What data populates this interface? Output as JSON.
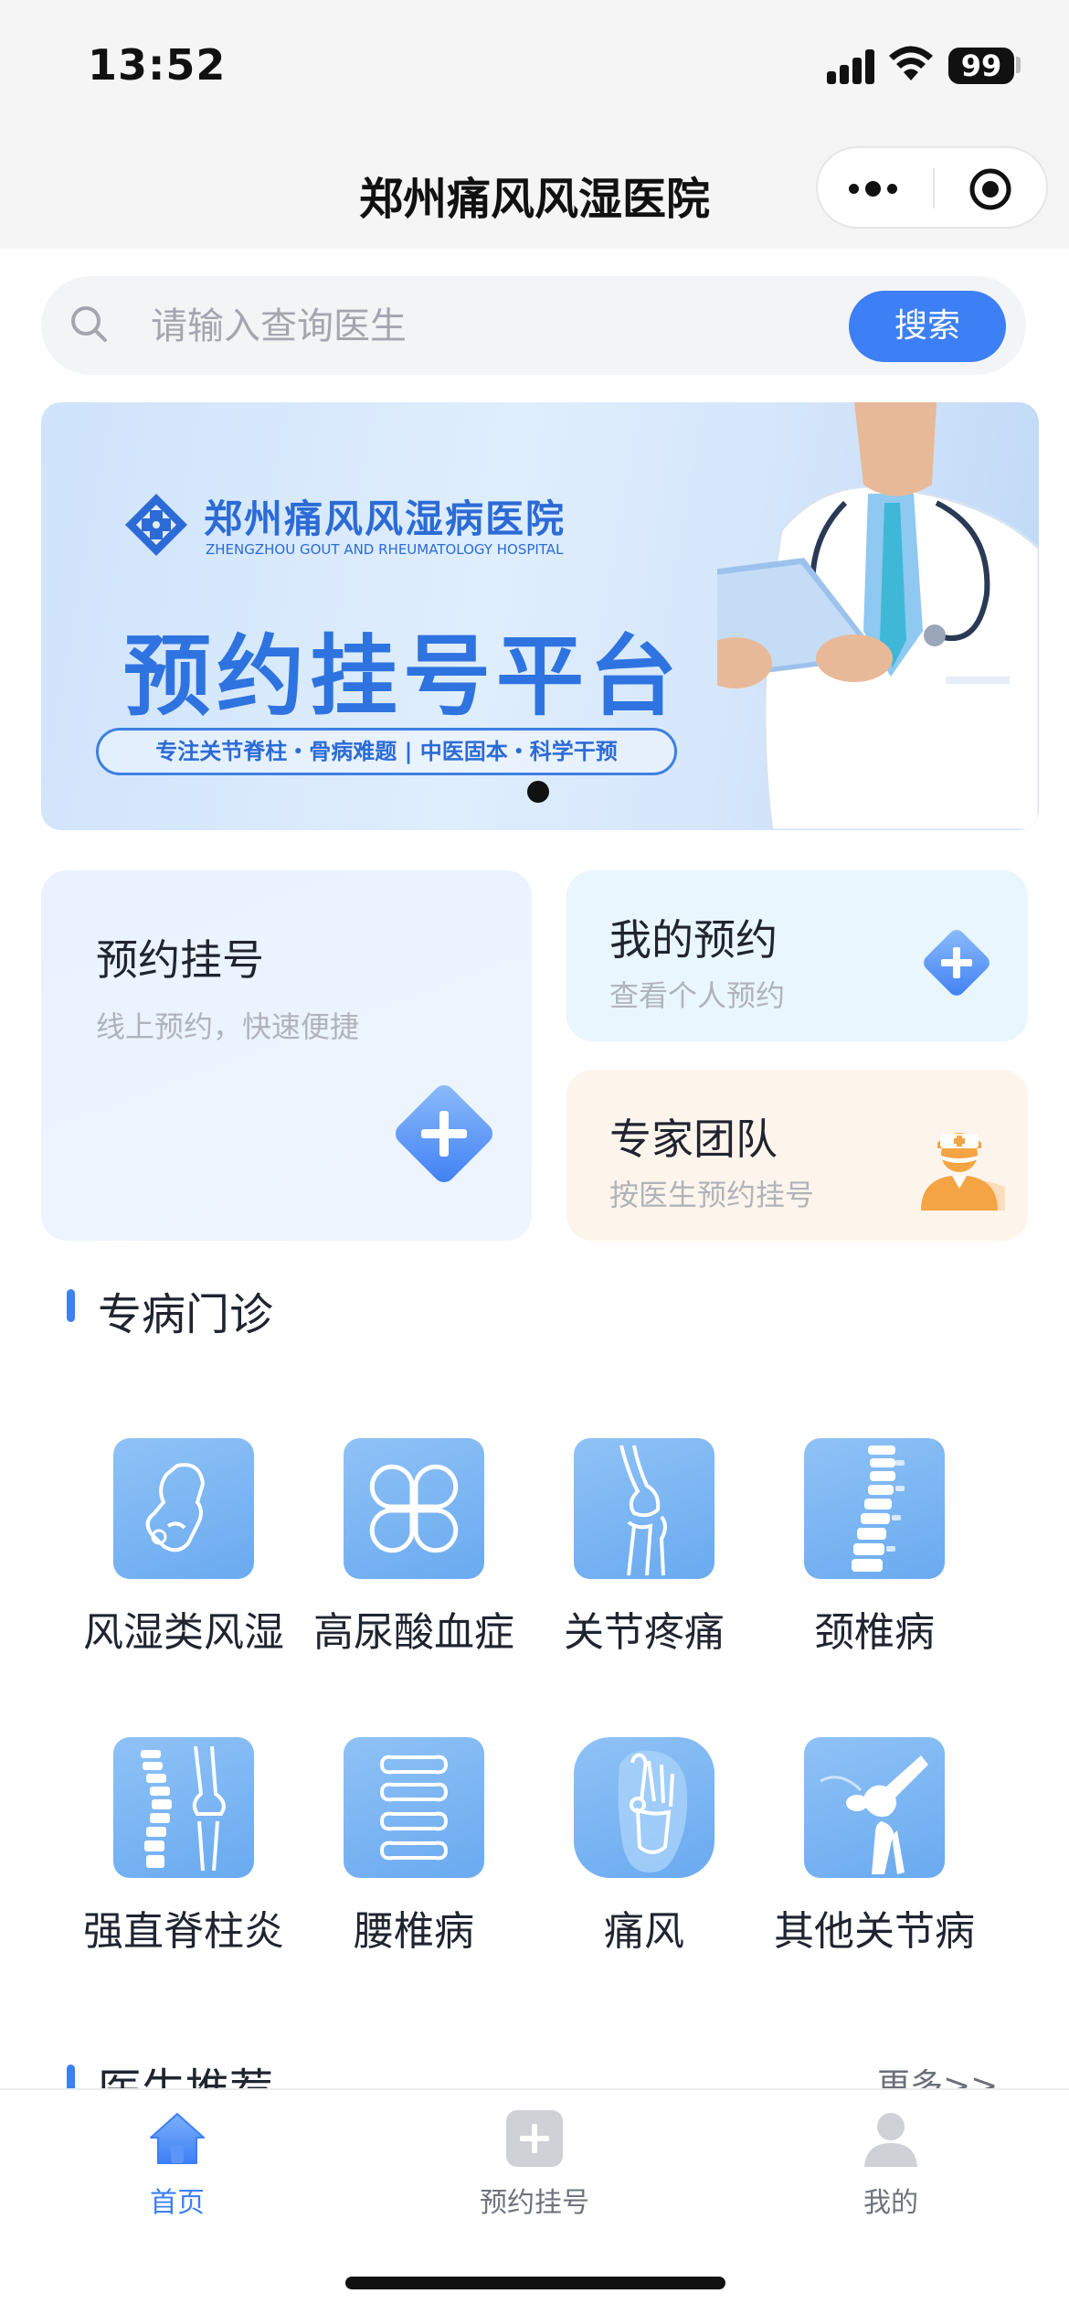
{
  "status_bar": {
    "time": "13:52",
    "battery": "99"
  },
  "nav": {
    "title": "郑州痛风风湿医院"
  },
  "search": {
    "placeholder": "请输入查询医生",
    "button_label": "搜索"
  },
  "banner": {
    "hospital_name": "郑州痛风风湿病医院",
    "hospital_name_en": "ZHENGZHOU GOUT AND RHEUMATOLOGY HOSPITAL",
    "title": "预约挂号平台",
    "tagline": "专注关节脊柱・骨病难题 | 中医固本・科学干预",
    "carousel_count": 1,
    "carousel_active": 1
  },
  "cards": {
    "booking": {
      "title": "预约挂号",
      "subtitle": "线上预约，快速便捷",
      "icon": "plus-diamond-icon"
    },
    "my_appointments": {
      "title": "我的预约",
      "subtitle": "查看个人预约",
      "icon": "plus-diamond-icon"
    },
    "expert_team": {
      "title": "专家团队",
      "subtitle": "按医生预约挂号",
      "icon": "doctor-icon"
    }
  },
  "specialty": {
    "heading": "专病门诊",
    "items": [
      {
        "label": "风湿类风湿",
        "icon": "hand-joint-icon"
      },
      {
        "label": "高尿酸血症",
        "icon": "clover-icon"
      },
      {
        "label": "关节疼痛",
        "icon": "knee-joint-icon"
      },
      {
        "label": "颈椎病",
        "icon": "cervical-spine-icon"
      },
      {
        "label": "强直脊柱炎",
        "icon": "spine-knee-icon"
      },
      {
        "label": "腰椎病",
        "icon": "lumbar-vertebrae-icon"
      },
      {
        "label": "痛风",
        "icon": "foot-bone-icon"
      },
      {
        "label": "其他关节病",
        "icon": "knee-bone-icon"
      }
    ]
  },
  "doctors": {
    "heading": "医生推荐",
    "more_label": "更多>>"
  },
  "tabbar": {
    "items": [
      {
        "label": "首页",
        "icon": "home-icon",
        "active": true
      },
      {
        "label": "预约挂号",
        "icon": "plus-square-icon",
        "active": false
      },
      {
        "label": "我的",
        "icon": "person-icon",
        "active": false
      }
    ]
  },
  "colors": {
    "accent": "#3d7ff5",
    "banner_text": "#2f73e0",
    "tile": "#7ab4f3",
    "team_icon": "#f5a443"
  }
}
